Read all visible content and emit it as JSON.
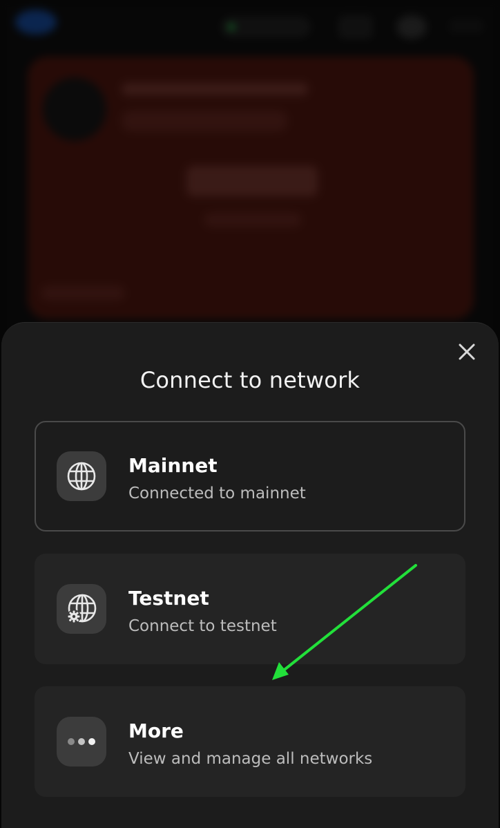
{
  "background": {
    "network_badge": "",
    "card_colors": {
      "card": "#3d120c"
    }
  },
  "sheet": {
    "title": "Connect to network",
    "close_icon": "close-icon",
    "options": [
      {
        "title": "Mainnet",
        "subtitle": "Connected to mainnet",
        "icon": "globe-icon",
        "selected": true
      },
      {
        "title": "Testnet",
        "subtitle": "Connect to testnet",
        "icon": "globe-gear-icon",
        "selected": false
      },
      {
        "title": "More",
        "subtitle": "View and manage all networks",
        "icon": "more-dots-icon",
        "selected": false
      }
    ]
  },
  "annotation": {
    "arrow_color": "#22e03a"
  }
}
